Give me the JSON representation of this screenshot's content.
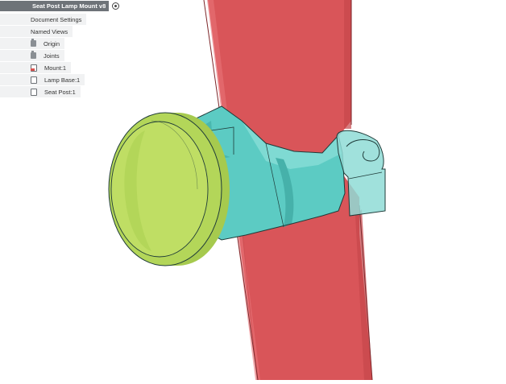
{
  "browser": {
    "root": {
      "label": "Seat Post Lamp Mount v8"
    },
    "items": [
      {
        "label": "Document Settings",
        "icon": "none"
      },
      {
        "label": "Named Views",
        "icon": "none"
      },
      {
        "label": "Origin",
        "icon": "folder-icon"
      },
      {
        "label": "Joints",
        "icon": "folder-icon"
      },
      {
        "label": "Mount:1",
        "icon": "component-active-icon"
      },
      {
        "label": "Lamp Base:1",
        "icon": "component-icon"
      },
      {
        "label": "Seat Post:1",
        "icon": "component-icon"
      }
    ]
  },
  "model": {
    "colors": {
      "seat_post": "#d95559",
      "lamp_base": "#bfde64",
      "mount": "#5ccbc3",
      "clip": "#8fdcd6"
    }
  }
}
